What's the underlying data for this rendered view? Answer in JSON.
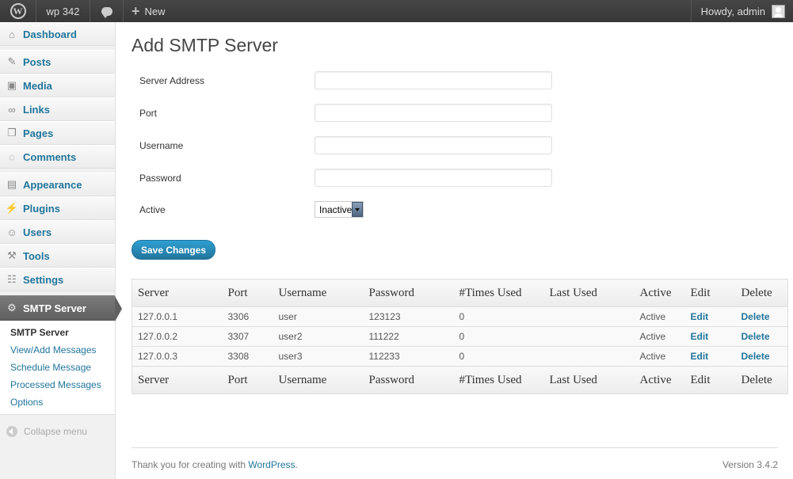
{
  "adminbar": {
    "site_name": "wp 342",
    "new_label": "New",
    "howdy": "Howdy, admin"
  },
  "sidebar": {
    "items": [
      {
        "label": "Dashboard",
        "icon": "home-icon"
      },
      {
        "label": "Posts",
        "icon": "pin-icon"
      },
      {
        "label": "Media",
        "icon": "media-icon"
      },
      {
        "label": "Links",
        "icon": "link-icon"
      },
      {
        "label": "Pages",
        "icon": "pages-icon"
      },
      {
        "label": "Comments",
        "icon": "comment-icon"
      },
      {
        "label": "Appearance",
        "icon": "appearance-icon"
      },
      {
        "label": "Plugins",
        "icon": "plugin-icon"
      },
      {
        "label": "Users",
        "icon": "users-icon"
      },
      {
        "label": "Tools",
        "icon": "tools-icon"
      },
      {
        "label": "Settings",
        "icon": "settings-icon"
      },
      {
        "label": "SMTP Server",
        "icon": "gear-icon"
      }
    ],
    "submenu": [
      "SMTP Server",
      "View/Add Messages",
      "Schedule Message",
      "Processed Messages",
      "Options"
    ],
    "collapse": "Collapse menu"
  },
  "page": {
    "title": "Add SMTP Server",
    "fields": {
      "server_address": "Server Address",
      "port": "Port",
      "username": "Username",
      "password": "Password",
      "active": "Active"
    },
    "active_value": "Inactive",
    "save_label": "Save Changes"
  },
  "table": {
    "headers": [
      "Server",
      "Port",
      "Username",
      "Password",
      "#Times Used",
      "Last Used",
      "Active",
      "Edit",
      "Delete"
    ],
    "rows": [
      [
        "127.0.0.1",
        "3306",
        "user",
        "123123",
        "0",
        "",
        "Active",
        "Edit",
        "Delete"
      ],
      [
        "127.0.0.2",
        "3307",
        "user2",
        "111222",
        "0",
        "",
        "Active",
        "Edit",
        "Delete"
      ],
      [
        "127.0.0.3",
        "3308",
        "user3",
        "112233",
        "0",
        "",
        "Active",
        "Edit",
        "Delete"
      ]
    ]
  },
  "footer": {
    "thanks": "Thank you for creating with ",
    "wp_link": "WordPress",
    "period": ".",
    "version": "Version 3.4.2"
  },
  "colors": {
    "link": "#21759b",
    "adminbar": "#464646",
    "button": "#21759b"
  }
}
